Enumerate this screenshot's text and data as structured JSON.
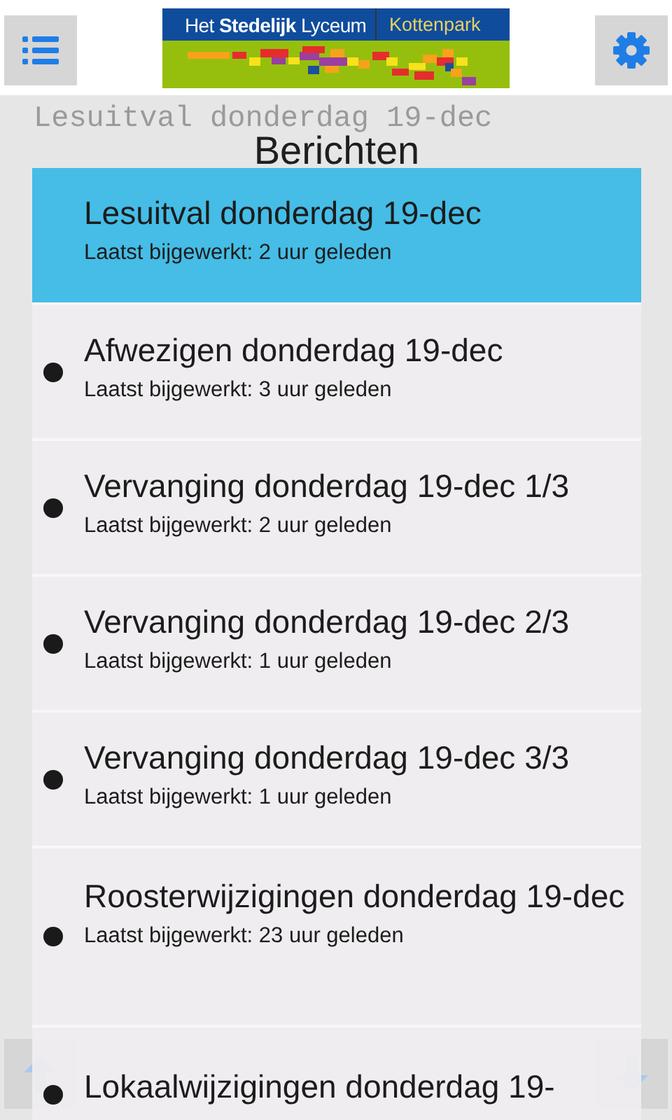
{
  "header": {
    "logo": {
      "name": "Het **Stedelijk** Lyceum",
      "location": "Kottenpark"
    }
  },
  "background": {
    "title": "Lesuitval donderdag 19-dec"
  },
  "dialog": {
    "title": "Berichten",
    "items": [
      {
        "title": "Lesuitval donderdag 19-dec",
        "subtitle": "Laatst bijgewerkt: 2 uur geleden",
        "selected": true
      },
      {
        "title": "Afwezigen donderdag 19-dec",
        "subtitle": "Laatst bijgewerkt: 3 uur geleden",
        "selected": false
      },
      {
        "title": "Vervanging donderdag 19-dec 1/3",
        "subtitle": "Laatst bijgewerkt: 2 uur geleden",
        "selected": false
      },
      {
        "title": "Vervanging donderdag 19-dec 2/3",
        "subtitle": "Laatst bijgewerkt: 1 uur geleden",
        "selected": false
      },
      {
        "title": "Vervanging donderdag 19-dec 3/3",
        "subtitle": "Laatst bijgewerkt: 1 uur geleden",
        "selected": false
      },
      {
        "title": "Roosterwijzigingen donderdag 19-dec",
        "subtitle": "Laatst bijgewerkt: 23 uur geleden",
        "selected": false
      },
      {
        "title": "Lokaalwijzigingen donderdag 19-",
        "selected": false
      }
    ]
  }
}
